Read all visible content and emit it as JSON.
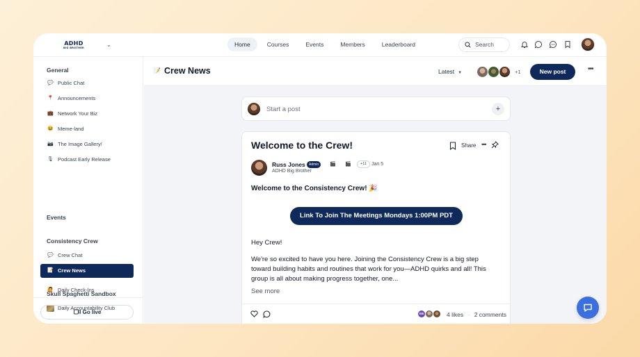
{
  "app": {
    "logo_line1": "ADHD",
    "logo_line2": "BIG BROTHER",
    "accent": "#0f2a5a",
    "fab_color": "#3b6fe0"
  },
  "nav": {
    "items": [
      {
        "label": "Home",
        "active": true
      },
      {
        "label": "Courses"
      },
      {
        "label": "Events"
      },
      {
        "label": "Members"
      },
      {
        "label": "Leaderboard"
      }
    ],
    "search_label": "Search",
    "icons": [
      "bell-icon",
      "chat-bubble-icon",
      "messages-icon",
      "bookmark-icon"
    ]
  },
  "sidebar": {
    "sections": [
      {
        "title": "General",
        "items": [
          {
            "emoji": "💬",
            "label": "Public Chat"
          },
          {
            "emoji": "📍",
            "label": "Announcements"
          },
          {
            "emoji": "💼",
            "label": "Network Your Biz"
          },
          {
            "emoji": "😆",
            "label": "Meme-land"
          },
          {
            "emoji": "📷",
            "label": "The Image Gallery!"
          },
          {
            "emoji": "🎙",
            "label": "Podcast Early Release"
          }
        ]
      },
      {
        "title": "Events",
        "items": []
      },
      {
        "title": "Consistency Crew",
        "items": [
          {
            "emoji": "💬",
            "label": "Crew Chat"
          },
          {
            "emoji": "📝",
            "label": "Crew News",
            "active": true
          }
        ]
      },
      {
        "title": "Skull Spaghetti Sandbox",
        "items": [
          {
            "emoji": "",
            "label": "Daily Accountability Club"
          },
          {
            "emoji": "🙋",
            "label": "Daily Check-Ins"
          }
        ]
      }
    ],
    "go_live": "Go live"
  },
  "main": {
    "emoji": "📝",
    "title": "Crew News",
    "sort_label": "Latest",
    "members_more": "+1",
    "new_post": "New post"
  },
  "composer": {
    "placeholder": "Start a post"
  },
  "post": {
    "title": "Welcome to the Crew!",
    "share": "Share",
    "author": "Russ Jones",
    "badge": "Admin",
    "extra_badges": "+11",
    "date": "Jan 5",
    "author_subtitle": "ADHD Big Brother",
    "subtitle": "Welcome to the Consistency Crew! 🎉",
    "button": "Link To Join The Meetings Mondays 1:00PM PDT",
    "greeting": "Hey Crew!",
    "body_lines": [
      "We're so excited to have you here. Joining the Consistency Crew is a big step",
      "toward building habits and routines that work for you—ADHD quirks and all! This",
      "group is all about making progress together, one..."
    ],
    "see_more": "See more",
    "reactor_initials": "EB",
    "likes": "4 likes",
    "separator": "·",
    "comments": "2 comments"
  }
}
